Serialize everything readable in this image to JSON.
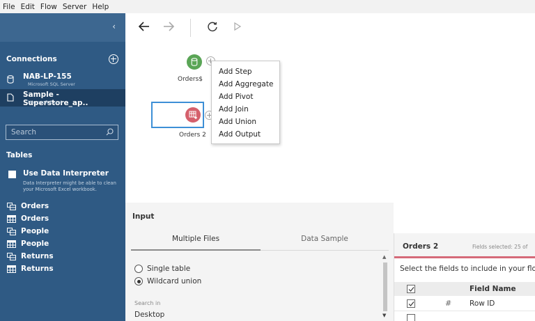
{
  "menu": [
    "File",
    "Edit",
    "Flow",
    "Server",
    "Help"
  ],
  "sidebar": {
    "connections_title": "Connections",
    "connections": [
      {
        "name": "NAB-LP-155",
        "sub": "Microsoft SQL Server",
        "icon": "database-icon",
        "selected": false
      },
      {
        "name": "Sample - Superstore_ap..",
        "sub": "Microsoft Excel",
        "icon": "file-icon",
        "selected": true
      }
    ],
    "search_placeholder": "Search",
    "tables_title": "Tables",
    "interpreter_label": "Use Data Interpreter",
    "interpreter_sub": "Data Interpreter might be able to clean your Microsoft Excel workbook.",
    "tables": [
      {
        "label": "Orders",
        "icon": "named-range-icon"
      },
      {
        "label": "Orders",
        "icon": "sheet-icon"
      },
      {
        "label": "People",
        "icon": "named-range-icon"
      },
      {
        "label": "People",
        "icon": "sheet-icon"
      },
      {
        "label": "Returns",
        "icon": "named-range-icon"
      },
      {
        "label": "Returns",
        "icon": "sheet-icon"
      }
    ]
  },
  "canvas": {
    "node1_label": "Orders$",
    "node2_label": "Orders 2",
    "context_menu": [
      "Add Step",
      "Add Aggregate",
      "Add Pivot",
      "Add Join",
      "Add Union",
      "Add Output"
    ]
  },
  "input": {
    "title": "Input",
    "tabs": [
      "Multiple Files",
      "Data Sample"
    ],
    "options": [
      "Single table",
      "Wildcard union"
    ],
    "selected_option": "Wildcard union",
    "search_in_label": "Search in",
    "search_in_value": "Desktop"
  },
  "fields": {
    "name": "Orders 2",
    "selected_text": "Fields selected: 25 of",
    "hint": "Select the fields to include in your flow",
    "header": "Field Name",
    "rows": [
      {
        "type": "#",
        "name": "Row ID",
        "checked": true
      }
    ]
  },
  "colors": {
    "sidebar": "#2f5a84",
    "input_node": "#5aa556",
    "union_node": "#d5606c",
    "selection": "#3d8fd6"
  }
}
